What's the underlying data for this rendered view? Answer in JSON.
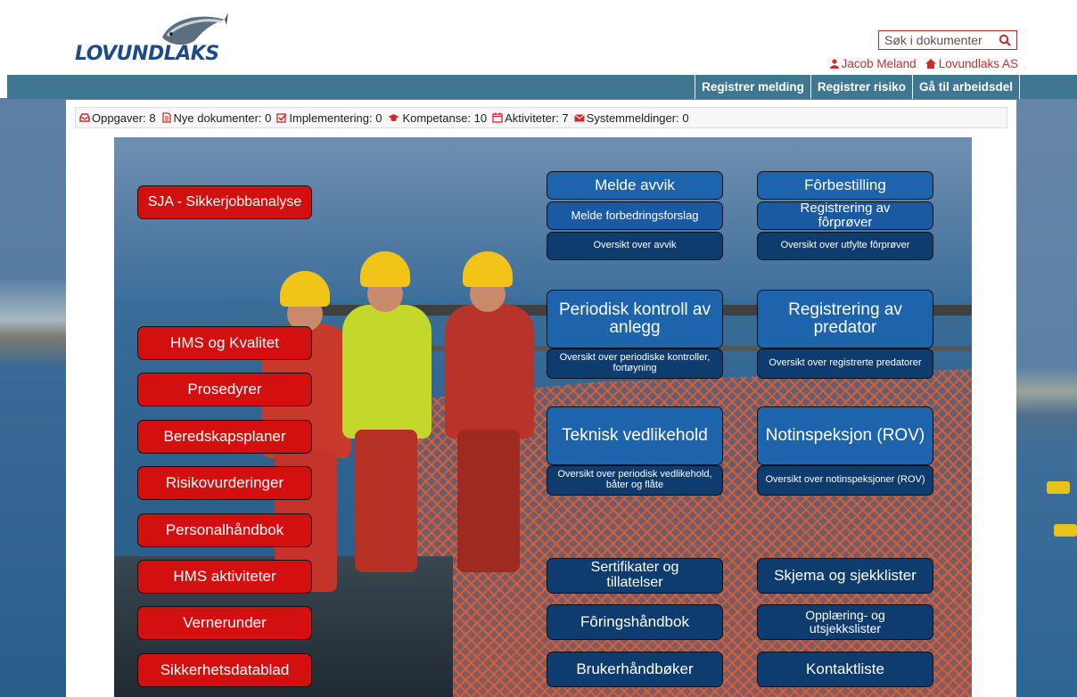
{
  "brand": {
    "logo_text": "LOVUNDLAKS"
  },
  "search": {
    "placeholder": "Søk i dokumenter",
    "icon": "search-icon"
  },
  "user": {
    "name": "Jacob Meland",
    "company": "Lovundlaks AS"
  },
  "nav": {
    "items": [
      "Registrer melding",
      "Registrer risiko",
      "Gå til arbeidsdel"
    ]
  },
  "status": {
    "items": [
      {
        "label": "Oppgaver: 8",
        "icon": "inbox-icon"
      },
      {
        "label": "Nye dokumenter: 0",
        "icon": "document-icon"
      },
      {
        "label": "Implementering: 0",
        "icon": "checkbox-icon"
      },
      {
        "label": "Kompetanse: 10",
        "icon": "graduation-cap-icon"
      },
      {
        "label": "Aktiviteter: 7",
        "icon": "calendar-icon"
      },
      {
        "label": "Systemmeldinger: 0",
        "icon": "envelope-icon"
      }
    ]
  },
  "left_buttons": [
    "SJA - Sikkerjobbanalyse",
    "HMS og Kvalitet",
    "Prosedyrer",
    "Beredskapsplaner",
    "Risikovurderinger",
    "Personalhåndbok",
    "HMS aktiviteter",
    "Vernerunder",
    "Sikkerhetsdatablad"
  ],
  "mid_col": {
    "melde_avvik": "Melde avvik",
    "melde_forbedring": "Melde forbedringsforslag",
    "oversikt_avvik": "Oversikt over avvik",
    "periodisk": "Periodisk kontroll av anlegg",
    "oversikt_periodisk": "Oversikt over periodiske kontroller, fortøyning",
    "teknisk": "Teknisk vedlikehold",
    "oversikt_vedlikehold": "Oversikt over periodisk vedlikehold, båter og flåte",
    "sertifikater": "Sertifikater og tillatelser",
    "foringshandbok": "Fôringshåndbok",
    "brukerhandboker": "Brukerhåndbøker"
  },
  "right_col": {
    "forbestilling": "Fôrbestilling",
    "registrering_forprover": "Registrering av fôrprøver",
    "oversikt_forprover": "Oversikt over utfylte fôrprøver",
    "registrering_predator": "Registrering av predator",
    "oversikt_predatorer": "Oversikt over registrerte predatorer",
    "notinspeksjon": "Notinspeksjon (ROV)",
    "oversikt_notinspeksjoner": "Oversikt over notinspeksjoner (ROV)",
    "skjema": "Skjema og sjekklister",
    "opplaering": "Opplæring- og utsjekkslister",
    "kontaktliste": "Kontaktliste"
  },
  "colors": {
    "red_button": "#d40f0f",
    "blue_button": "#1d64ad",
    "dark_blue_button": "#0e3c6e",
    "navbar": "#3f7692",
    "accent_red": "#c9302c"
  }
}
